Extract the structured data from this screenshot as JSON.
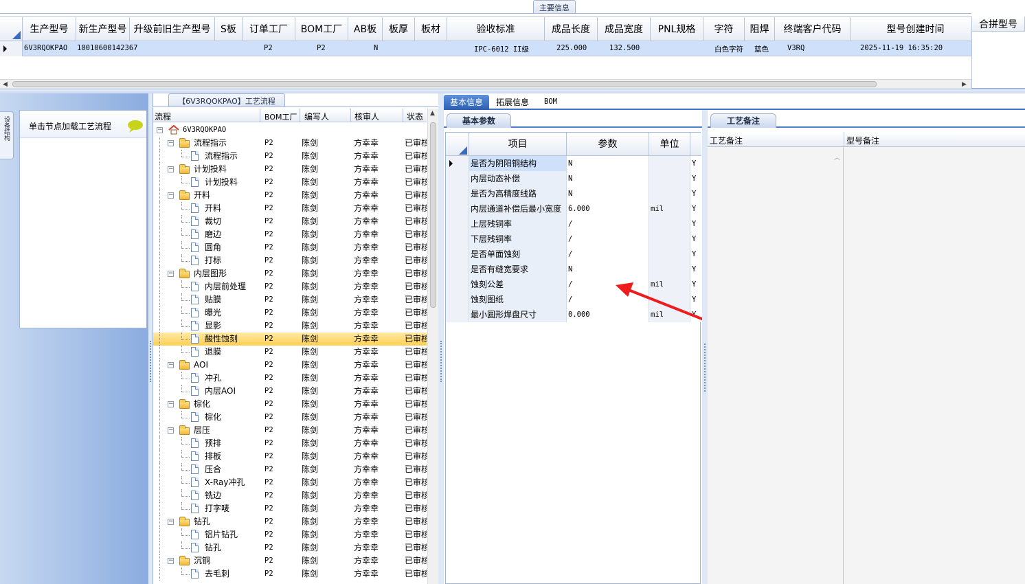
{
  "main_info": {
    "caption": "主要信息",
    "columns": [
      "生产型号",
      "新生产型号",
      "升级前旧生产型号",
      "S板",
      "订单工厂",
      "BOM工厂",
      "AB板",
      "板厚",
      "板材",
      "验收标准",
      "成品长度",
      "成品宽度",
      "PNL规格",
      "字符",
      "阻焊",
      "终端客户代码",
      "型号创建时间"
    ],
    "right_caption": "合拼型号",
    "row": {
      "prod_model": "6V3RQOKPAO",
      "new_model": "10010600142367",
      "old_model": "",
      "s_board": "",
      "order_factory": "P2",
      "bom_factory": "P2",
      "ab_board": "N",
      "thickness": "",
      "material": "",
      "standard": "IPC-6012 II级",
      "length": "225.000",
      "width": "132.500",
      "pnl": "",
      "char": "白色字符",
      "mask": "蓝色",
      "customer": "V3RQ",
      "created": "2025-11-19 16:35:20"
    }
  },
  "left_panel": {
    "side_tab": "设备结构",
    "load_hint": "单击节点加载工艺流程"
  },
  "flow": {
    "caption": "【6V3RQOKPAO】工艺流程",
    "headers": {
      "flow": "流程",
      "bom": "BOM工厂",
      "writer": "编写人",
      "reviewer": "核审人",
      "status": "状态"
    },
    "root": "6V3RQOKPAO",
    "rows": [
      {
        "name": "流程指示",
        "level": 1,
        "bom": "P2",
        "writer": "陈剑",
        "reviewer": "方幸幸",
        "status": "已审核"
      },
      {
        "name": "流程指示",
        "level": 2,
        "bom": "P2",
        "writer": "陈剑",
        "reviewer": "方幸幸",
        "status": "已审核"
      },
      {
        "name": "计划投料",
        "level": 1,
        "bom": "P2",
        "writer": "陈剑",
        "reviewer": "方幸幸",
        "status": "已审核"
      },
      {
        "name": "计划投料",
        "level": 2,
        "bom": "P2",
        "writer": "陈剑",
        "reviewer": "方幸幸",
        "status": "已审核"
      },
      {
        "name": "开料",
        "level": 1,
        "bom": "P2",
        "writer": "陈剑",
        "reviewer": "方幸幸",
        "status": "已审核"
      },
      {
        "name": "开料",
        "level": 2,
        "bom": "P2",
        "writer": "陈剑",
        "reviewer": "方幸幸",
        "status": "已审核"
      },
      {
        "name": "裁切",
        "level": 2,
        "bom": "P2",
        "writer": "陈剑",
        "reviewer": "方幸幸",
        "status": "已审核"
      },
      {
        "name": "磨边",
        "level": 2,
        "bom": "P2",
        "writer": "陈剑",
        "reviewer": "方幸幸",
        "status": "已审核"
      },
      {
        "name": "圆角",
        "level": 2,
        "bom": "P2",
        "writer": "陈剑",
        "reviewer": "方幸幸",
        "status": "已审核"
      },
      {
        "name": "打标",
        "level": 2,
        "bom": "P2",
        "writer": "陈剑",
        "reviewer": "方幸幸",
        "status": "已审核"
      },
      {
        "name": "内层图形",
        "level": 1,
        "bom": "P2",
        "writer": "陈剑",
        "reviewer": "方幸幸",
        "status": "已审核"
      },
      {
        "name": "内层前处理",
        "level": 2,
        "bom": "P2",
        "writer": "陈剑",
        "reviewer": "方幸幸",
        "status": "已审核"
      },
      {
        "name": "贴膜",
        "level": 2,
        "bom": "P2",
        "writer": "陈剑",
        "reviewer": "方幸幸",
        "status": "已审核"
      },
      {
        "name": "曝光",
        "level": 2,
        "bom": "P2",
        "writer": "陈剑",
        "reviewer": "方幸幸",
        "status": "已审核"
      },
      {
        "name": "显影",
        "level": 2,
        "bom": "P2",
        "writer": "陈剑",
        "reviewer": "方幸幸",
        "status": "已审核"
      },
      {
        "name": "酸性蚀刻",
        "level": 2,
        "bom": "P2",
        "writer": "陈剑",
        "reviewer": "方幸幸",
        "status": "已审核",
        "selected": true
      },
      {
        "name": "退膜",
        "level": 2,
        "bom": "P2",
        "writer": "陈剑",
        "reviewer": "方幸幸",
        "status": "已审核"
      },
      {
        "name": "AOI",
        "level": 1,
        "bom": "P2",
        "writer": "陈剑",
        "reviewer": "方幸幸",
        "status": "已审核"
      },
      {
        "name": "冲孔",
        "level": 2,
        "bom": "P2",
        "writer": "陈剑",
        "reviewer": "方幸幸",
        "status": "已审核"
      },
      {
        "name": "内层AOI",
        "level": 2,
        "bom": "P2",
        "writer": "陈剑",
        "reviewer": "方幸幸",
        "status": "已审核"
      },
      {
        "name": "棕化",
        "level": 1,
        "bom": "P2",
        "writer": "陈剑",
        "reviewer": "方幸幸",
        "status": "已审核"
      },
      {
        "name": "棕化",
        "level": 2,
        "bom": "P2",
        "writer": "陈剑",
        "reviewer": "方幸幸",
        "status": "已审核"
      },
      {
        "name": "层压",
        "level": 1,
        "bom": "P2",
        "writer": "陈剑",
        "reviewer": "方幸幸",
        "status": "已审核"
      },
      {
        "name": "预排",
        "level": 2,
        "bom": "P2",
        "writer": "陈剑",
        "reviewer": "方幸幸",
        "status": "已审核"
      },
      {
        "name": "排板",
        "level": 2,
        "bom": "P2",
        "writer": "陈剑",
        "reviewer": "方幸幸",
        "status": "已审核"
      },
      {
        "name": "压合",
        "level": 2,
        "bom": "P2",
        "writer": "陈剑",
        "reviewer": "方幸幸",
        "status": "已审核"
      },
      {
        "name": "X-Ray冲孔",
        "level": 2,
        "bom": "P2",
        "writer": "陈剑",
        "reviewer": "方幸幸",
        "status": "已审核"
      },
      {
        "name": "铣边",
        "level": 2,
        "bom": "P2",
        "writer": "陈剑",
        "reviewer": "方幸幸",
        "status": "已审核"
      },
      {
        "name": "打字唛",
        "level": 2,
        "bom": "P2",
        "writer": "陈剑",
        "reviewer": "方幸幸",
        "status": "已审核"
      },
      {
        "name": "钻孔",
        "level": 1,
        "bom": "P2",
        "writer": "陈剑",
        "reviewer": "方幸幸",
        "status": "已审核"
      },
      {
        "name": "铝片钻孔",
        "level": 2,
        "bom": "P2",
        "writer": "陈剑",
        "reviewer": "方幸幸",
        "status": "已审核"
      },
      {
        "name": "钻孔",
        "level": 2,
        "bom": "P2",
        "writer": "陈剑",
        "reviewer": "方幸幸",
        "status": "已审核"
      },
      {
        "name": "沉铜",
        "level": 1,
        "bom": "P2",
        "writer": "陈剑",
        "reviewer": "方幸幸",
        "status": "已审核"
      },
      {
        "name": "去毛刺",
        "level": 2,
        "bom": "P2",
        "writer": "陈剑",
        "reviewer": "方幸幸",
        "status": "已审核"
      }
    ]
  },
  "detail_tabs": [
    "基本信息",
    "拓展信息",
    "BOM"
  ],
  "params": {
    "caption": "基本参数",
    "headers": {
      "item": "项目",
      "value": "参数",
      "unit": "单位"
    },
    "rows": [
      {
        "item": "是否为阴阳铜结构",
        "value": "N",
        "unit": "",
        "flag": "Y"
      },
      {
        "item": "内层动态补偿",
        "value": "N",
        "unit": "",
        "flag": "Y"
      },
      {
        "item": "是否为高精度线路",
        "value": "N",
        "unit": "",
        "flag": "Y"
      },
      {
        "item": "内层通道补偿后最小宽度",
        "value": "6.000",
        "unit": "mil",
        "flag": "Y"
      },
      {
        "item": "上层残铜率",
        "value": "/",
        "unit": "",
        "flag": "Y"
      },
      {
        "item": "下层残铜率",
        "value": "/",
        "unit": "",
        "flag": "Y"
      },
      {
        "item": "是否单面蚀刻",
        "value": "/",
        "unit": "",
        "flag": "Y"
      },
      {
        "item": "是否有缝宽要求",
        "value": "N",
        "unit": "",
        "flag": "Y"
      },
      {
        "item": "蚀刻公差",
        "value": "/",
        "unit": "mil",
        "flag": "Y"
      },
      {
        "item": "蚀刻图纸",
        "value": "/",
        "unit": "",
        "flag": "Y"
      },
      {
        "item": "最小圆形焊盘尺寸",
        "value": "0.000",
        "unit": "mil",
        "flag": "Y"
      }
    ]
  },
  "notes": {
    "caption": "工艺备注",
    "col1": "工艺备注",
    "col2": "型号备注"
  },
  "colors": {
    "selection": "#cfe0fb",
    "tree_selected": "#ffd96b",
    "annotation_arrow": "#ee1c1c",
    "panel_gradient_top": "#dbe6f6",
    "panel_gradient_bottom": "#7ea3da"
  }
}
